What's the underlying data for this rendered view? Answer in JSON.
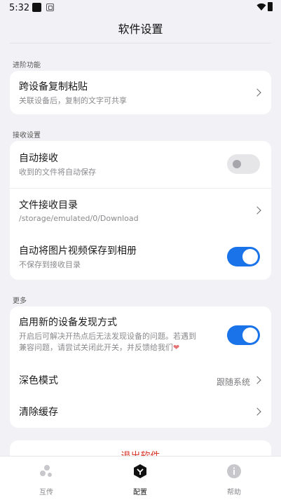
{
  "status": {
    "time": "5:32"
  },
  "title": "软件设置",
  "sections": {
    "advanced": "进阶功能",
    "receive": "接收设置",
    "more": "更多"
  },
  "cross_clipboard": {
    "title": "跨设备复制粘贴",
    "subtitle": "关联设备后，复制的文字可共享"
  },
  "auto_receive": {
    "title": "自动接收",
    "subtitle": "收到的文件将自动保存",
    "enabled": false
  },
  "receive_dir": {
    "title": "文件接收目录",
    "subtitle": "/storage/emulated/0/Download"
  },
  "save_album": {
    "title": "自动将图片视频保存到相册",
    "subtitle": "不保存到接收目录",
    "enabled": true
  },
  "new_discovery": {
    "title": "启用新的设备发现方式",
    "subtitle_line1": "开启后可解决开热点后无法发现设备的问题。若遇到",
    "subtitle_line2": "兼容问题，请尝试关闭此开关，并反馈给我们",
    "enabled": true
  },
  "dark_mode": {
    "title": "深色模式",
    "value": "跟随系统"
  },
  "clear_cache": {
    "title": "清除缓存"
  },
  "exit": {
    "label": "退出软件"
  },
  "nav": {
    "transfer": "互传",
    "config": "配置",
    "help": "帮助"
  },
  "colors": {
    "accent": "#1a73e8",
    "exit": "#d93a2e"
  }
}
